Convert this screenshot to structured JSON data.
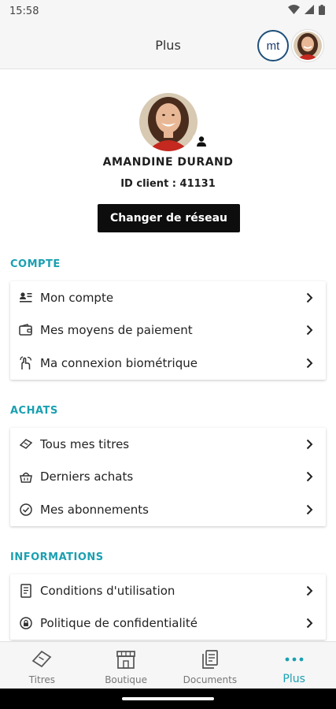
{
  "status_bar": {
    "time": "15:58"
  },
  "header": {
    "title": "Plus",
    "network_logo_text": "mt"
  },
  "profile": {
    "name": "AMANDINE DURAND",
    "client_id": "ID client : 41131",
    "change_network_label": "Changer de réseau"
  },
  "sections": {
    "compte": {
      "title": "COMPTE",
      "items": [
        {
          "label": "Mon compte",
          "icon": "account-card-icon"
        },
        {
          "label": "Mes moyens de paiement",
          "icon": "wallet-icon"
        },
        {
          "label": "Ma connexion biométrique",
          "icon": "biometric-hand-icon"
        }
      ]
    },
    "achats": {
      "title": "ACHATS",
      "items": [
        {
          "label": "Tous mes titres",
          "icon": "ticket-icon"
        },
        {
          "label": "Derniers achats",
          "icon": "basket-icon"
        },
        {
          "label": "Mes abonnements",
          "icon": "subscription-icon"
        }
      ]
    },
    "informations": {
      "title": "INFORMATIONS",
      "items": [
        {
          "label": "Conditions d'utilisation",
          "icon": "document-icon"
        },
        {
          "label": "Politique de confidentialité",
          "icon": "privacy-icon"
        }
      ]
    }
  },
  "bottom_nav": {
    "items": [
      {
        "label": "Titres",
        "icon": "ticket-icon"
      },
      {
        "label": "Boutique",
        "icon": "shop-icon"
      },
      {
        "label": "Documents",
        "icon": "documents-icon"
      },
      {
        "label": "Plus",
        "icon": "more-dots-icon",
        "active": true
      }
    ]
  },
  "colors": {
    "accent": "#1ba0b1",
    "button_bg": "#0d0d0d",
    "header_bg": "#f6f6f6"
  }
}
